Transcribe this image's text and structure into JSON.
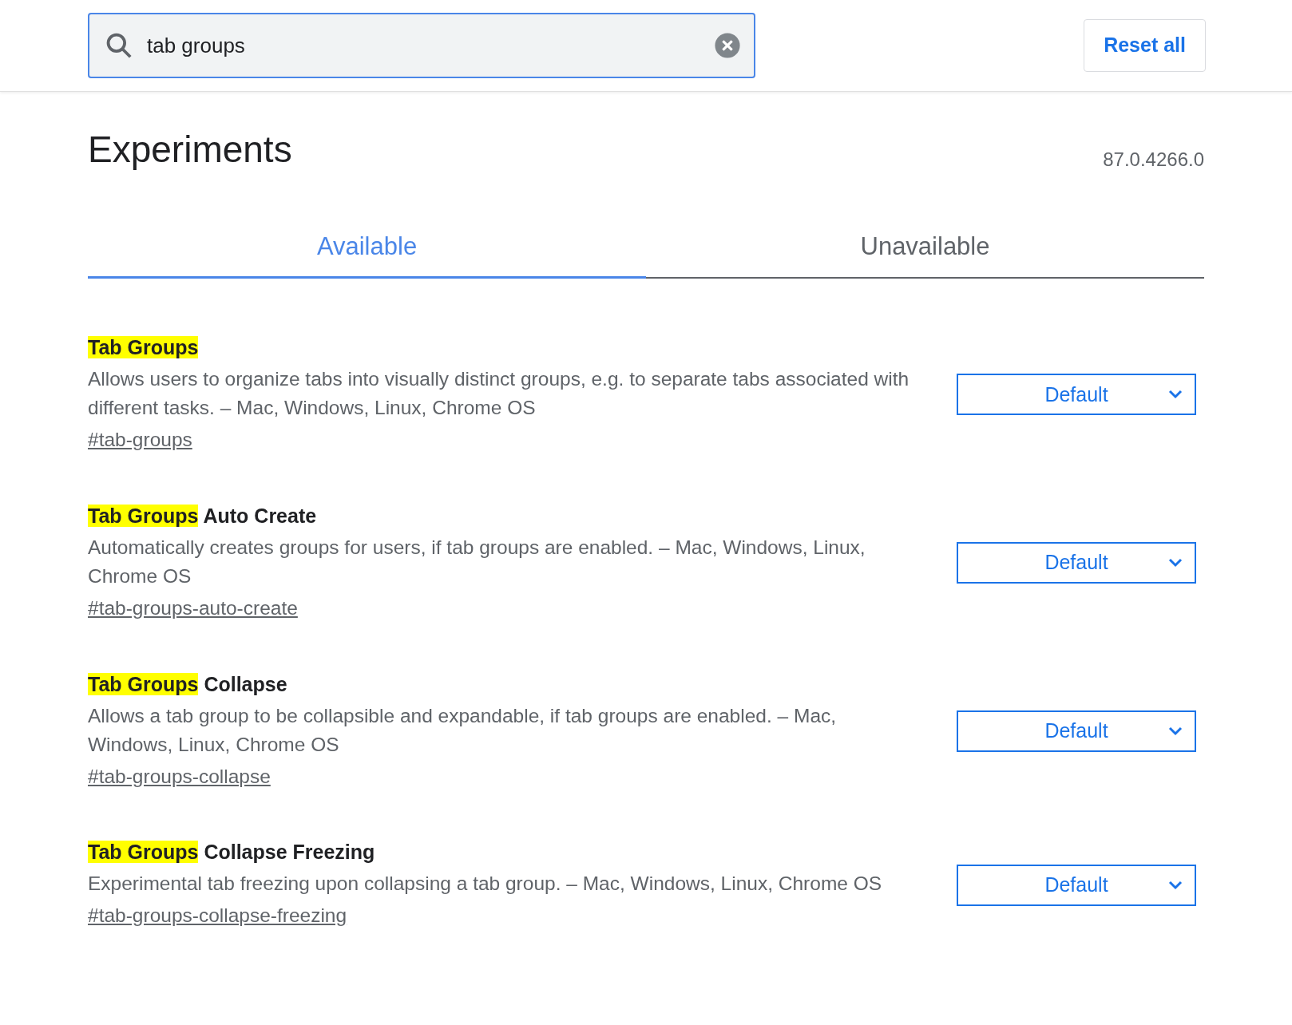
{
  "search": {
    "value": "tab groups"
  },
  "reset_button": "Reset all",
  "title": "Experiments",
  "version": "87.0.4266.0",
  "tabs": [
    {
      "label": "Available",
      "selected": true
    },
    {
      "label": "Unavailable",
      "selected": false
    }
  ],
  "experiments": [
    {
      "match": "Tab Groups",
      "description": "Allows users to organize tabs into visually distinct groups, e.g. to separate tabs associated with different tasks. – Mac, Windows, Linux, Chrome OS",
      "link": "#tab-groups",
      "select": "Default"
    },
    {
      "match": "Tab Groups",
      "rest": "Auto Create",
      "description": "Automatically creates groups for users, if tab groups are enabled. – Mac, Windows, Linux, Chrome OS",
      "link": "#tab-groups-auto-create",
      "select": "Default"
    },
    {
      "match": "Tab Groups",
      "rest": "Collapse",
      "description": "Allows a tab group to be collapsible and expandable, if tab groups are enabled. – Mac, Windows, Linux, Chrome OS",
      "link": "#tab-groups-collapse",
      "select": "Default"
    },
    {
      "match": "Tab Groups",
      "rest": "Collapse Freezing",
      "description": "Experimental tab freezing upon collapsing a tab group. – Mac, Windows, Linux, Chrome OS",
      "link": "#tab-groups-collapse-freezing",
      "select": "Default"
    }
  ]
}
